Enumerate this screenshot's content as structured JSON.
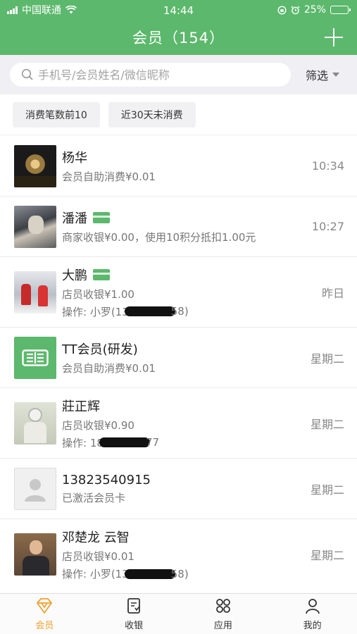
{
  "status": {
    "carrier": "中国联通",
    "time": "14:44",
    "battery": "25%",
    "battery_level": 0.25
  },
  "nav": {
    "title": "会员（154）"
  },
  "search": {
    "placeholder": "手机号/会员姓名/微信昵称",
    "filter_label": "筛选"
  },
  "chips": [
    "消费笔数前10",
    "近30天未消费"
  ],
  "members": [
    {
      "name": "杨华",
      "has_card": false,
      "lines": [
        "会员自助消费¥0.01"
      ],
      "time": "10:34",
      "avatar": "photo-night"
    },
    {
      "name": "潘潘",
      "has_card": true,
      "lines": [
        "商家收银¥0.00，使用10积分抵扣1.00元"
      ],
      "time": "10:27",
      "avatar": "photo-crowd"
    },
    {
      "name": "大鹏",
      "has_card": true,
      "lines": [
        "店员收银¥1.00"
      ],
      "op": {
        "prefix": "操作: 小罗(13",
        "suffix": "58)"
      },
      "time": "昨日",
      "avatar": "photo-snow"
    },
    {
      "name": "TT会员(研发)",
      "has_card": false,
      "lines": [
        "会员自助消费¥0.01"
      ],
      "time": "星期二",
      "avatar": "logo-green"
    },
    {
      "name": "莊正辉",
      "has_card": false,
      "lines": [
        "店员收银¥0.90"
      ],
      "op": {
        "prefix": "操作: 18",
        "suffix": "77"
      },
      "time": "星期二",
      "avatar": "photo-astronaut"
    },
    {
      "name": "13823540915",
      "has_card": false,
      "lines": [
        "已激活会员卡"
      ],
      "time": "星期二",
      "avatar": "default-person"
    },
    {
      "name": "邓楚龙 云智",
      "has_card": false,
      "lines": [
        "店员收银¥0.01"
      ],
      "op": {
        "prefix": "操作: 小罗(13",
        "suffix": "58)"
      },
      "time": "星期二",
      "avatar": "photo-portrait"
    }
  ],
  "tabs": [
    {
      "label": "会员",
      "icon": "diamond-icon",
      "active": true
    },
    {
      "label": "收银",
      "icon": "receipt-icon",
      "active": false
    },
    {
      "label": "应用",
      "icon": "apps-grid-icon",
      "active": false
    },
    {
      "label": "我的",
      "icon": "person-icon",
      "active": false
    }
  ],
  "colors": {
    "brand": "#5cb86c",
    "active_tab": "#f0a030"
  }
}
